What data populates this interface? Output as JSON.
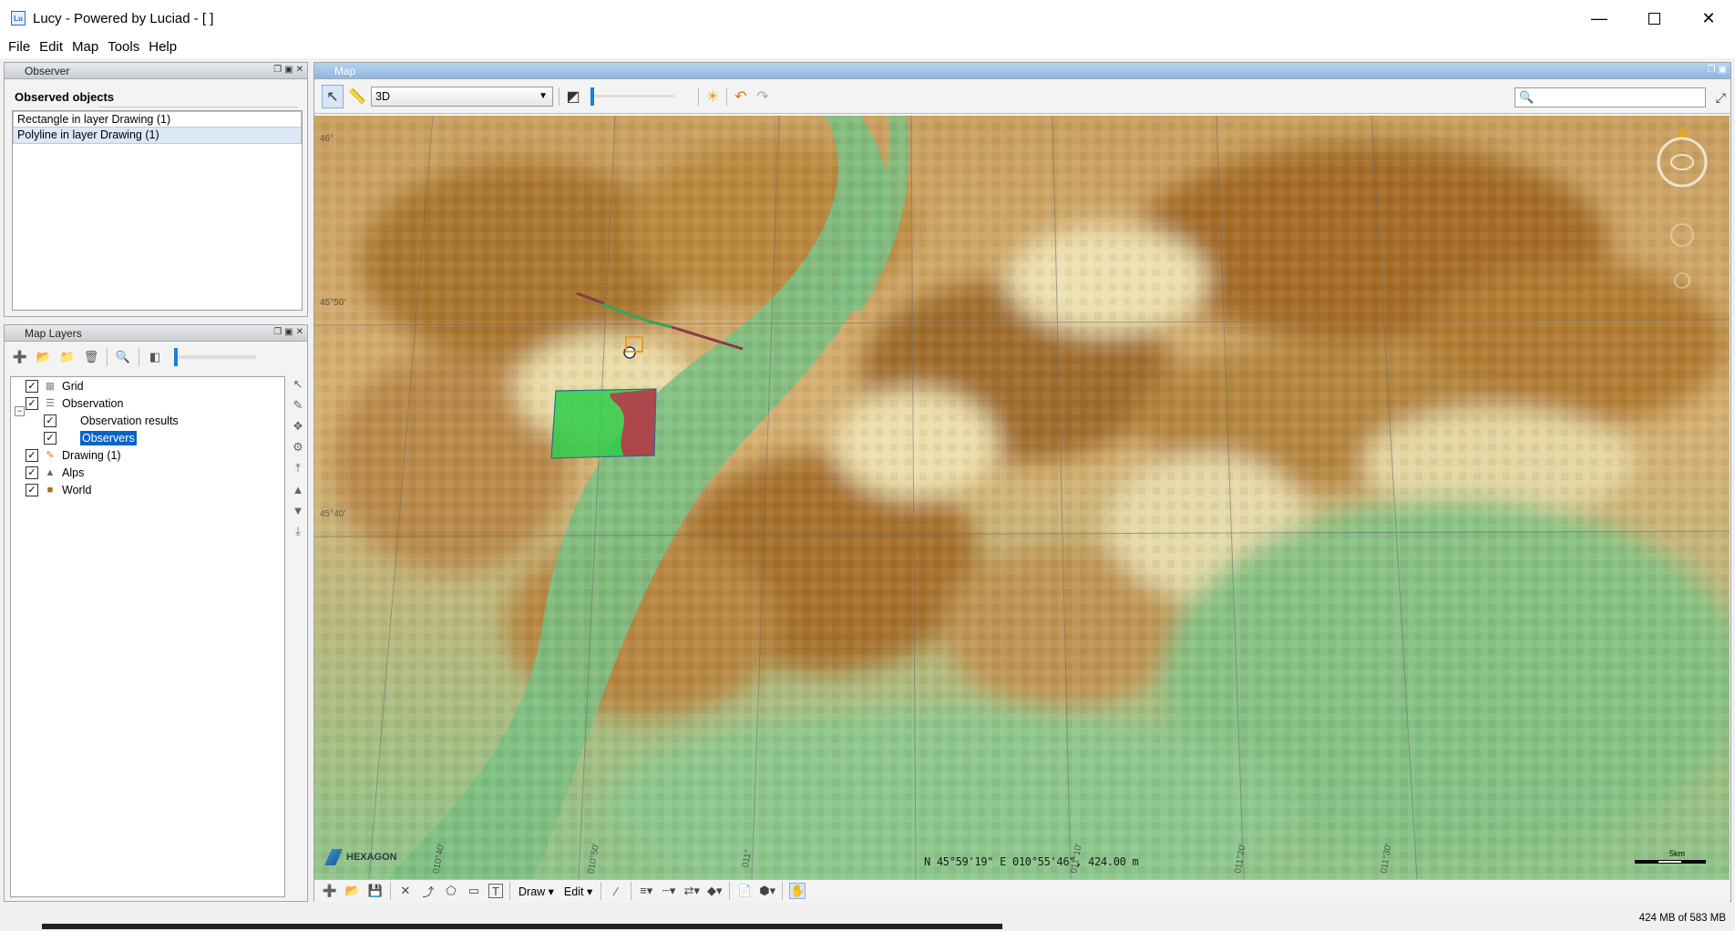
{
  "window": {
    "title": "Lucy - Powered by Luciad - [ ]",
    "app_icon": "Lu",
    "minimize_icon": "minimize-icon",
    "maximize_icon": "maximize-icon",
    "close_icon": "close-icon"
  },
  "menu": [
    "File",
    "Edit",
    "Map",
    "Tools",
    "Help"
  ],
  "observer": {
    "panel_title": "Observer",
    "section_title": "Observed objects",
    "items": [
      {
        "label": "Rectangle in layer Drawing (1)",
        "selected": false
      },
      {
        "label": "Polyline in layer Drawing (1)",
        "selected": true
      }
    ]
  },
  "layers": {
    "panel_title": "Map Layers",
    "tree": [
      {
        "label": "Grid",
        "checked": true,
        "indent": 0,
        "icon": "grid-icon"
      },
      {
        "label": "Observation",
        "checked": true,
        "indent": 0,
        "icon": "layer-group-icon",
        "expanded": true
      },
      {
        "label": "Observation results",
        "checked": true,
        "indent": 1,
        "icon": ""
      },
      {
        "label": "Observers",
        "checked": true,
        "indent": 1,
        "icon": "",
        "selected": true
      },
      {
        "label": "Drawing (1)",
        "checked": true,
        "indent": 0,
        "icon": "drawing-icon"
      },
      {
        "label": "Alps",
        "checked": true,
        "indent": 0,
        "icon": "terrain-icon"
      },
      {
        "label": "World",
        "checked": true,
        "indent": 0,
        "icon": "world-icon"
      }
    ],
    "opacity": 0.0
  },
  "map": {
    "panel_title": "Map",
    "view_mode": "3D",
    "slider_value": 0.0,
    "coordinates": "N 45°59'19\" E 010°55'46\", 424.00 m",
    "scale_label": "5km",
    "brand": "HEXAGON",
    "grid_labels": [
      "46°",
      "45°50'",
      "45°40'",
      "010°40'",
      "010°50'",
      "011°",
      "011°10'",
      "011°20'",
      "011°30'"
    ],
    "bottom_toolbar": {
      "draw_label": "Draw",
      "edit_label": "Edit"
    }
  },
  "status": {
    "memory": "424 MB of 583 MB"
  },
  "colors": {
    "accent": "#1c7fd6",
    "selection": "#0a64c8",
    "visible_area": "#2ecc4a",
    "hidden_area": "#b8384a"
  }
}
